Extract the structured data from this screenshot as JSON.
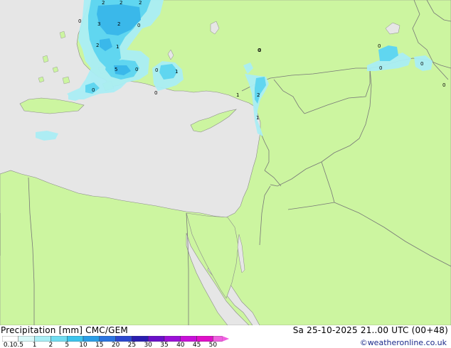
{
  "map": {
    "background_sea": "#e6e6e6",
    "land": "#ccf5a0",
    "border": "#777777",
    "precip_light": "#aaeef5",
    "precip_medium": "#60d6f0",
    "precip_heavy": "#3ab8ea",
    "labels": [
      "2",
      "2",
      "2",
      "0",
      "3",
      "2",
      "0",
      "2",
      "1",
      "0",
      "5",
      "0",
      "0",
      "1",
      "0",
      "0",
      "0",
      "1",
      "2",
      "1",
      "0",
      "0",
      "0",
      "0"
    ]
  },
  "footer": {
    "title": "Precipitation [mm]  CMC/GEM",
    "datetime": "Sa 25-10-2025 21..00 UTC (00+48)",
    "credit": "©weatheronline.co.uk",
    "legend_ticks": [
      "0.1",
      "0.5",
      "1",
      "2",
      "5",
      "10",
      "15",
      "20",
      "25",
      "30",
      "35",
      "40",
      "45",
      "50"
    ],
    "legend_colors": [
      "#ffffff",
      "#d8f8f8",
      "#a8eef5",
      "#70dcf0",
      "#3cc4ec",
      "#2a9ee6",
      "#2a74e0",
      "#2c48d0",
      "#2a1eb0",
      "#6a10c8",
      "#9c10d8",
      "#c810d8",
      "#e010c8",
      "#f060e0"
    ]
  }
}
